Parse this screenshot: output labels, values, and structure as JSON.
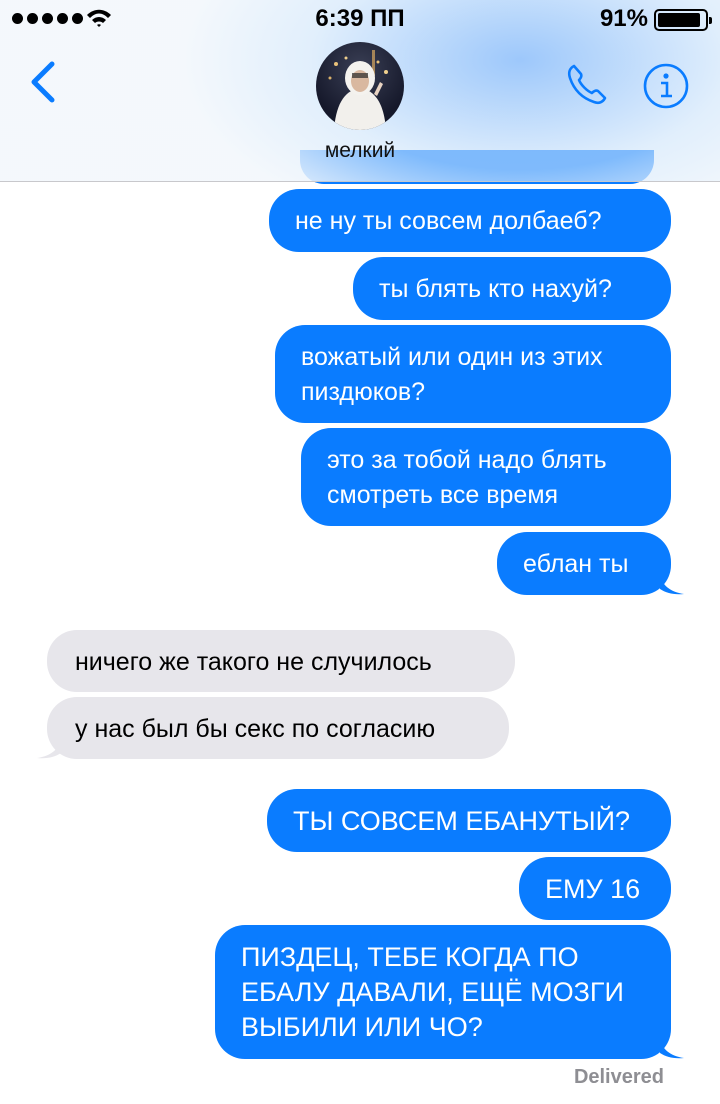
{
  "status_bar": {
    "time": "6:39 ПП",
    "battery_percent": "91%",
    "battery_level": 0.91,
    "signal_bars": 5
  },
  "header": {
    "contact_name": "мелкий",
    "icons": [
      "back-chevron-icon",
      "phone-icon",
      "info-icon"
    ]
  },
  "messages": [
    {
      "direction": "out",
      "text": "не ну ты совсем долбаеб?"
    },
    {
      "direction": "out",
      "text": "ты блять кто нахуй?"
    },
    {
      "direction": "out",
      "text": "вожатый или один из этих пиздюков?"
    },
    {
      "direction": "out",
      "text": "это за тобой надо блять смотреть все время"
    },
    {
      "direction": "out",
      "text": "еблан ты"
    },
    {
      "direction": "in",
      "text": "ничего же такого не случилось"
    },
    {
      "direction": "in",
      "text": "у нас был бы секс по согласию"
    },
    {
      "direction": "out",
      "text": "ТЫ СОВСЕМ ЕБАНУТЫЙ?"
    },
    {
      "direction": "out",
      "text": "ЕМУ 16"
    },
    {
      "direction": "out",
      "text": "ПИЗДЕЦ, ТЕБЕ КОГДА ПО ЕБАЛУ ДАВАЛИ, ЕЩЁ МОЗГИ ВЫБИЛИ ИЛИ ЧО?"
    }
  ],
  "delivered_label": "Delivered",
  "colors": {
    "outgoing_bubble": "#0a7cff",
    "incoming_bubble": "#e7e6eb",
    "accent": "#0a7cff"
  }
}
